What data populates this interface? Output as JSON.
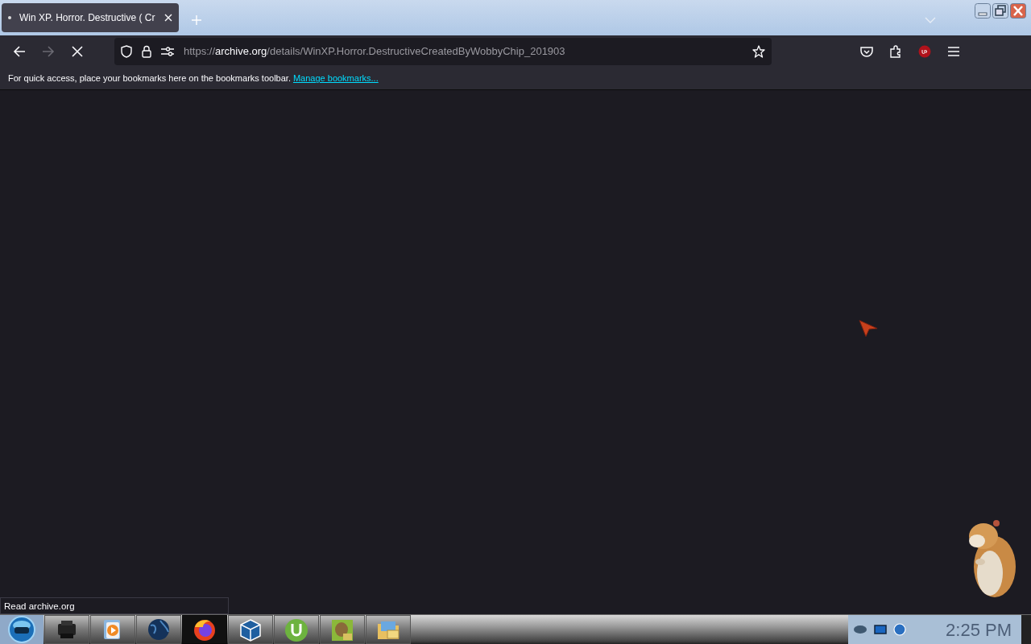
{
  "tabs": [
    {
      "title": "Win XP. Horror. Destructive ( Cr",
      "selected": true,
      "loading": true
    }
  ],
  "toolbar": {
    "url": {
      "scheme": "https://",
      "host": "archive.org",
      "path": "/details/WinXP.Horror.DestructiveCreatedByWobbyChip_201903"
    }
  },
  "bookmarks_bar": {
    "message": "For quick access, place your bookmarks here on the bookmarks toolbar.",
    "link": "Manage bookmarks..."
  },
  "status_text": "Read archive.org",
  "taskbar": {
    "apps": [
      {
        "kind": "printer",
        "selected": false
      },
      {
        "kind": "media",
        "selected": false
      },
      {
        "kind": "globe",
        "selected": false
      },
      {
        "kind": "firefox",
        "selected": true
      },
      {
        "kind": "cube",
        "selected": false
      },
      {
        "kind": "torrent",
        "selected": false
      },
      {
        "kind": "hamster",
        "selected": false
      },
      {
        "kind": "mail",
        "selected": false
      }
    ],
    "clock": "2:25 PM"
  }
}
